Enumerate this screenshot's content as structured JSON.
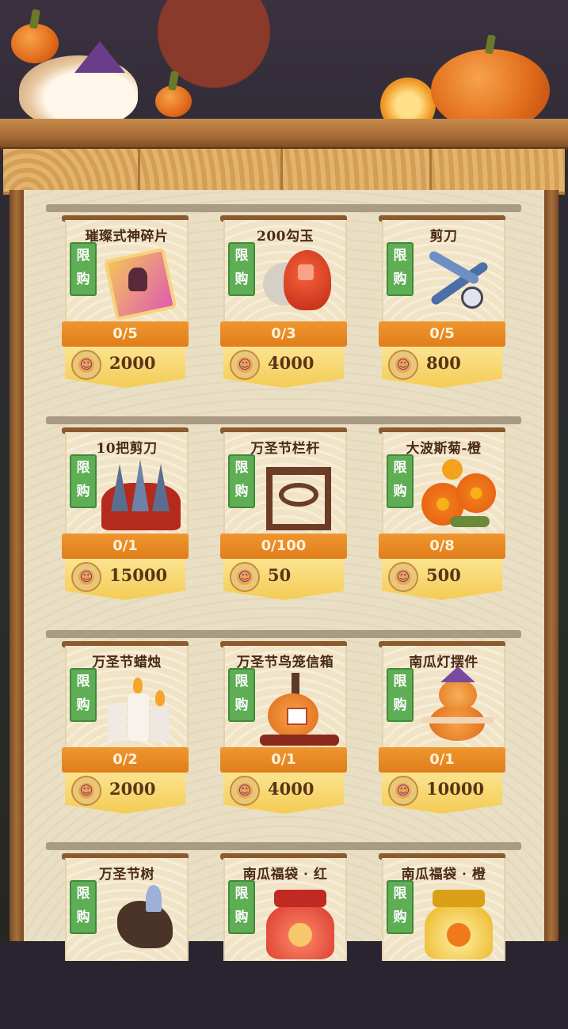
{
  "tag_lines": [
    "限",
    "购"
  ],
  "items": [
    {
      "name": "璀璨式神碎片",
      "count": "0/5",
      "price": "2000",
      "art": "shard-icon"
    },
    {
      "name": "200勾玉",
      "count": "0/3",
      "price": "4000",
      "art": "magatama-icon"
    },
    {
      "name": "剪刀",
      "count": "0/5",
      "price": "800",
      "art": "scissors-icon"
    },
    {
      "name": "10把剪刀",
      "count": "0/1",
      "price": "15000",
      "art": "scissors-bundle-icon"
    },
    {
      "name": "万圣节栏杆",
      "count": "0/100",
      "price": "50",
      "art": "railing-icon"
    },
    {
      "name": "大波斯菊-橙",
      "count": "0/8",
      "price": "500",
      "art": "cosmos-flower-icon"
    },
    {
      "name": "万圣节蜡烛",
      "count": "0/2",
      "price": "2000",
      "art": "candle-icon"
    },
    {
      "name": "万圣节鸟笼信箱",
      "count": "0/1",
      "price": "4000",
      "art": "birdcage-mailbox-icon"
    },
    {
      "name": "南瓜灯摆件",
      "count": "0/1",
      "price": "10000",
      "art": "pumpkin-lamp-icon"
    },
    {
      "name": "万圣节树",
      "count": "",
      "price": "",
      "art": "halloween-tree-icon"
    },
    {
      "name": "南瓜福袋 · 红",
      "count": "",
      "price": "",
      "art": "lucky-bag-red-icon"
    },
    {
      "name": "南瓜福袋 · 橙",
      "count": "",
      "price": "",
      "art": "lucky-bag-orange-icon"
    }
  ],
  "colors": {
    "accent": "#e07e1c",
    "tag": "#5fae56",
    "price_bg": "#f4cc55"
  }
}
